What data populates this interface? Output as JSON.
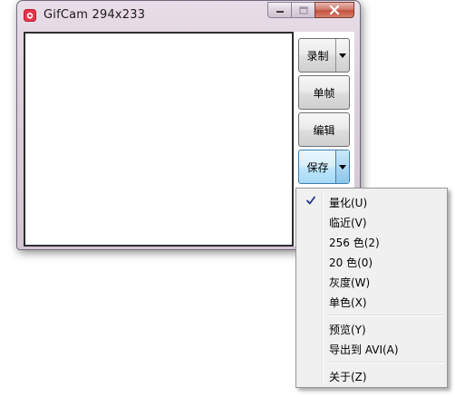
{
  "window": {
    "title": "GifCam 294x233"
  },
  "buttons": {
    "record": "录制",
    "frame": "单帧",
    "edit": "编辑",
    "save": "保存"
  },
  "menu": {
    "items": [
      {
        "label": "量化(U)",
        "checked": true
      },
      {
        "label": "临近(V)",
        "checked": false
      },
      {
        "label": "256 色(2)",
        "checked": false
      },
      {
        "label": "20 色(0)",
        "checked": false
      },
      {
        "label": "灰度(W)",
        "checked": false
      },
      {
        "label": "单色(X)",
        "checked": false
      },
      {
        "label": "预览(Y)",
        "checked": false
      },
      {
        "label": "导出到 AVI(A)",
        "checked": false
      },
      {
        "label": "关于(Z)",
        "checked": false
      }
    ]
  },
  "icons": {
    "app": "gifcam-camera-icon",
    "check": "checkmark-icon",
    "dropdown": "triangle-down-icon"
  },
  "colors": {
    "accent": "#3c7fb1",
    "app_icon": "#e8344a"
  }
}
